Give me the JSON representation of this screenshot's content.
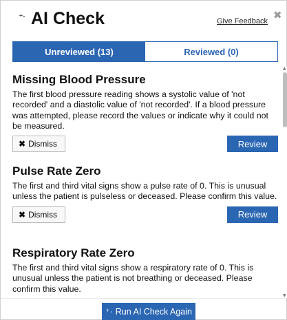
{
  "header": {
    "sparkle_icon": "⁺·",
    "title": "AI Check",
    "feedback_link": "Give Feedback",
    "close_glyph": "✖"
  },
  "tabs": [
    {
      "label": "Unreviewed (13)",
      "active": true
    },
    {
      "label": "Reviewed (0)",
      "active": false
    }
  ],
  "items": [
    {
      "title": "Missing Blood Pressure",
      "body": "The first blood pressure reading shows a systolic value of 'not recorded' and a diastolic value of 'not recorded'. If a blood pressure was attempted, please record the values or indicate why it could not be measured.",
      "dismiss_label": "Dismiss",
      "review_label": "Review"
    },
    {
      "title": "Pulse Rate Zero",
      "body": "The first and third vital signs show a pulse rate of 0. This is unusual unless the patient is pulseless or deceased. Please confirm this value.",
      "dismiss_label": "Dismiss",
      "review_label": "Review"
    },
    {
      "title": "Respiratory Rate Zero",
      "body": "The first and third vital signs show a respiratory rate of 0. This is unusual unless the patient is not breathing or deceased. Please confirm this value."
    }
  ],
  "footer": {
    "run_icon": "⁺·",
    "run_label": "Run AI Check Again"
  },
  "colors": {
    "accent": "#2b66b3",
    "close_icon": "#9a9a9a"
  }
}
